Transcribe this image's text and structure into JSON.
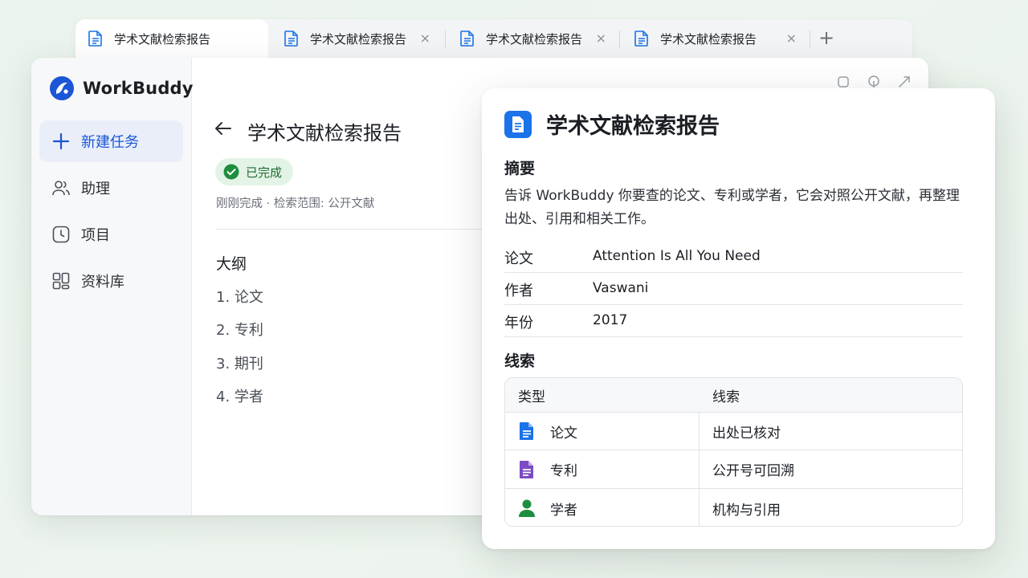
{
  "colors": {
    "accent": "#1a56d6",
    "success_bg": "#e3f3e6",
    "success_fg": "#1f6b32",
    "doc_blue": "#1a73e8",
    "patent_purple": "#7b4bc4",
    "scholar_green": "#1e8e3e"
  },
  "tabs": [
    {
      "label": "学术文献检索报告",
      "icon": "document-icon",
      "closable": false,
      "active": true
    },
    {
      "label": "学术文献检索报告",
      "icon": "document-icon",
      "closable": true,
      "active": false
    },
    {
      "label": "学术文献检索报告",
      "icon": "document-icon",
      "closable": true,
      "active": false
    },
    {
      "label": "学术文献检索报告",
      "icon": "document-icon",
      "closable": true,
      "active": false
    }
  ],
  "tab_close_glyph": "×",
  "new_tab_glyph": "+",
  "brand": {
    "name": "WorkBuddy"
  },
  "sidebar": {
    "items": [
      {
        "label": "新建任务",
        "icon": "plus-icon",
        "active": true
      },
      {
        "label": "助理",
        "icon": "people-icon",
        "active": false
      },
      {
        "label": "项目",
        "icon": "clock-icon",
        "active": false
      },
      {
        "label": "资料库",
        "icon": "grid-icon",
        "active": false
      }
    ]
  },
  "detail": {
    "title": "学术文献检索报告",
    "status": "已完成",
    "meta": "刚刚完成 · 检索范围: 公开文献",
    "outline_title": "大纲",
    "outline": [
      "1. 论文",
      "2. 专利",
      "3. 期刊",
      "4. 学者"
    ]
  },
  "card": {
    "title": "学术文献检索报告",
    "summary_label": "摘要",
    "summary": "告诉 WorkBuddy 你要查的论文、专利或学者，它会对照公开文献，再整理出处、引用和相关工作。",
    "fields": [
      {
        "key": "论文",
        "value": "Attention Is All You Need"
      },
      {
        "key": "作者",
        "value": "Vaswani"
      },
      {
        "key": "年份",
        "value": "2017"
      }
    ],
    "clues_label": "线索",
    "table": {
      "headers": [
        "类型",
        "线索"
      ],
      "rows": [
        {
          "type": "论文",
          "clue": "出处已核对",
          "icon": "document-icon"
        },
        {
          "type": "专利",
          "clue": "公开号可回溯",
          "icon": "patent-document-icon"
        },
        {
          "type": "学者",
          "clue": "机构与引用",
          "icon": "person-icon"
        }
      ]
    }
  }
}
